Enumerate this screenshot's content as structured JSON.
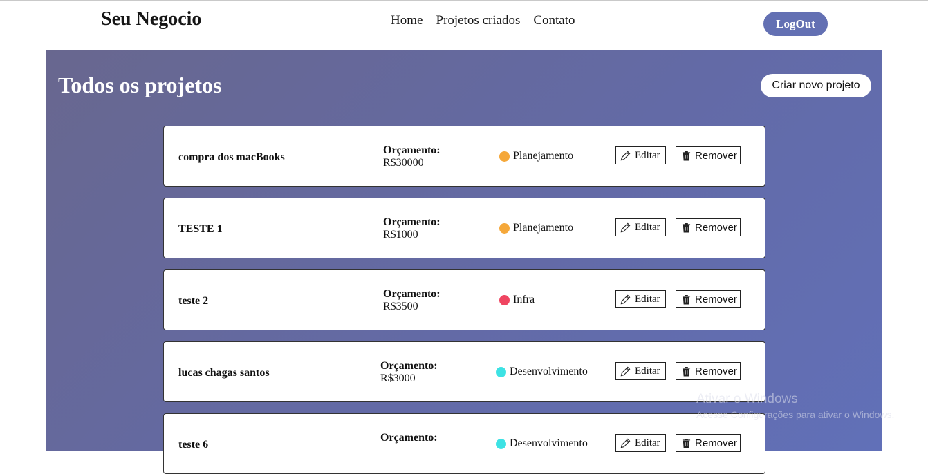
{
  "header": {
    "brand": "Seu Negocio",
    "nav": [
      "Home",
      "Projetos criados",
      "Contato"
    ],
    "logout_label": "LogOut"
  },
  "main": {
    "title": "Todos os projetos",
    "new_project_label": "Criar novo projeto"
  },
  "projects": [
    {
      "name": "compra dos macBooks",
      "budget_label": "Orçamento:",
      "budget": "R$30000",
      "status": "Planejamento",
      "status_color": "#f5a83a"
    },
    {
      "name": "TESTE 1",
      "budget_label": "Orçamento:",
      "budget": "R$1000",
      "status": "Planejamento",
      "status_color": "#f5a83a"
    },
    {
      "name": "teste 2",
      "budget_label": "Orçamento:",
      "budget": "R$3500",
      "status": "Infra",
      "status_color": "#ef4561"
    },
    {
      "name": "lucas chagas santos",
      "budget_label": "Orçamento:",
      "budget": "R$3000",
      "status": "Desenvolvimento",
      "status_color": "#3de2e4"
    },
    {
      "name": "teste 6",
      "budget_label": "Orçamento:",
      "budget": "",
      "status": "Desenvolvimento",
      "status_color": "#3de2e4"
    }
  ],
  "actions": {
    "edit_label": "Editar",
    "remove_label": "Remover",
    "edit_icon": "pencil-icon",
    "remove_icon": "trash-icon"
  },
  "watermark": {
    "line1": "Ativar o Windows",
    "line2": "Acesse Configurações para ativar o Windows."
  },
  "colors": {
    "accent": "#6370b3",
    "panel": "#6470b0"
  }
}
